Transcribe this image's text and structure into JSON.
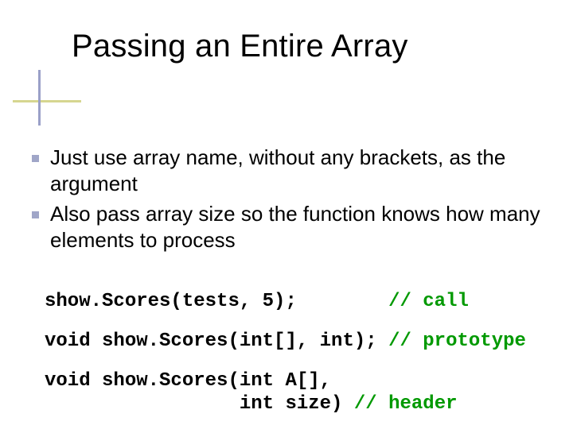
{
  "title": "Passing an Entire Array",
  "bullets": [
    "Just use array name, without any brackets, as the argument",
    "Also pass array size so the function knows how many elements to process"
  ],
  "code": {
    "line1": {
      "text": "show.Scores(tests, 5);       ",
      "comment": " // call"
    },
    "line2": {
      "text": "void show.Scores(int[], int);",
      "comment": " // prototype"
    },
    "line3": {
      "text": "void show.Scores(int A[],\n                 int size)",
      "comment": " // header"
    }
  }
}
